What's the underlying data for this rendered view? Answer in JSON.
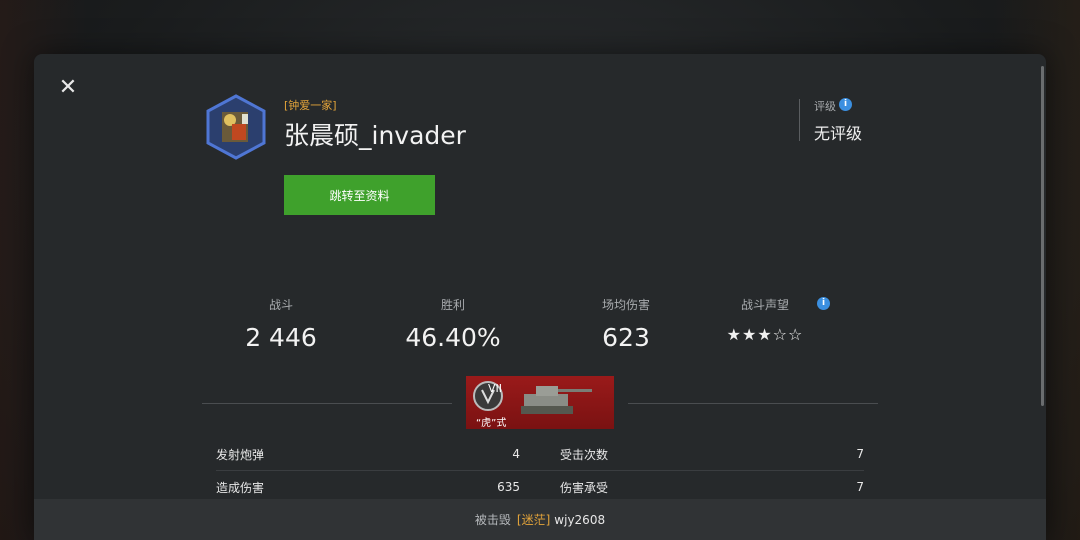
{
  "player": {
    "clan_tag": "[钟爱一家]",
    "name": "张晨硕_invader",
    "profile_button": "跳转至资料"
  },
  "rating": {
    "label": "评级",
    "value": "无评级"
  },
  "stats": [
    {
      "label": "战斗",
      "value": "2 446"
    },
    {
      "label": "胜利",
      "value": "46.40%"
    },
    {
      "label": "场均伤害",
      "value": "623"
    },
    {
      "label": "战斗声望",
      "stars": "★★★☆☆",
      "stars_filled": 3,
      "stars_total": 5
    }
  ],
  "tank": {
    "tier": "VII",
    "name": "“虎”式"
  },
  "details": [
    {
      "label": "发射炮弹",
      "value": "4"
    },
    {
      "label": "受击次数",
      "value": "7"
    },
    {
      "label": "造成伤害",
      "value": "635"
    },
    {
      "label": "伤害承受",
      "value": "7"
    }
  ],
  "footer": {
    "prefix": "被击毁",
    "killer_clan": "[迷茫]",
    "killer_name": "wjy2608"
  },
  "colors": {
    "accent_green": "#3fa12c",
    "clan_orange": "#e3a43a",
    "info_blue": "#3b8fe0",
    "tank_red": "#8a1616"
  }
}
